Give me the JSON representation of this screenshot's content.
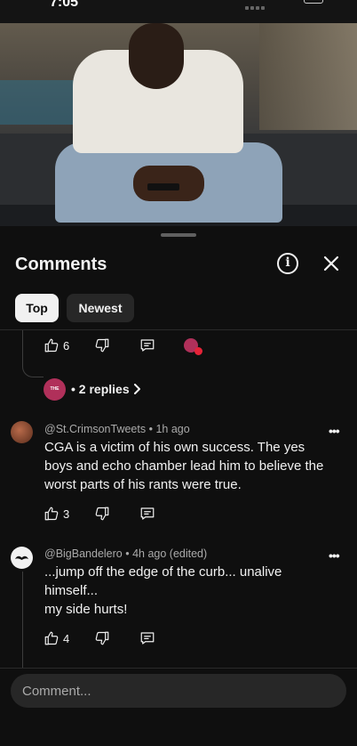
{
  "status_bar": {
    "time": "7:05"
  },
  "sheet": {
    "title": "Comments",
    "tabs": [
      {
        "label": "Top",
        "selected": true
      },
      {
        "label": "Newest",
        "selected": false
      }
    ]
  },
  "previous_comment": {
    "likes": "6",
    "replies_label": "• 2 replies",
    "avatar_text": "THE"
  },
  "comments": [
    {
      "author": "@St.CrimsonTweets",
      "time": "1h ago",
      "text": "CGA is a victim of his own success. The yes boys and echo chamber lead him to believe the worst parts of his rants were true.",
      "likes": "3"
    },
    {
      "author": "@BigBandelero",
      "time": "4h ago (edited)",
      "text_line1": "...jump off the edge of the curb... unalive himself...",
      "text_line2": "my side hurts!",
      "likes": "4"
    }
  ],
  "input": {
    "placeholder": "Comment..."
  },
  "colors": {
    "background": "#0f0f0f",
    "chip_active": "#f1f1f1",
    "chip_idle": "#272727",
    "heart": "#e62338"
  }
}
